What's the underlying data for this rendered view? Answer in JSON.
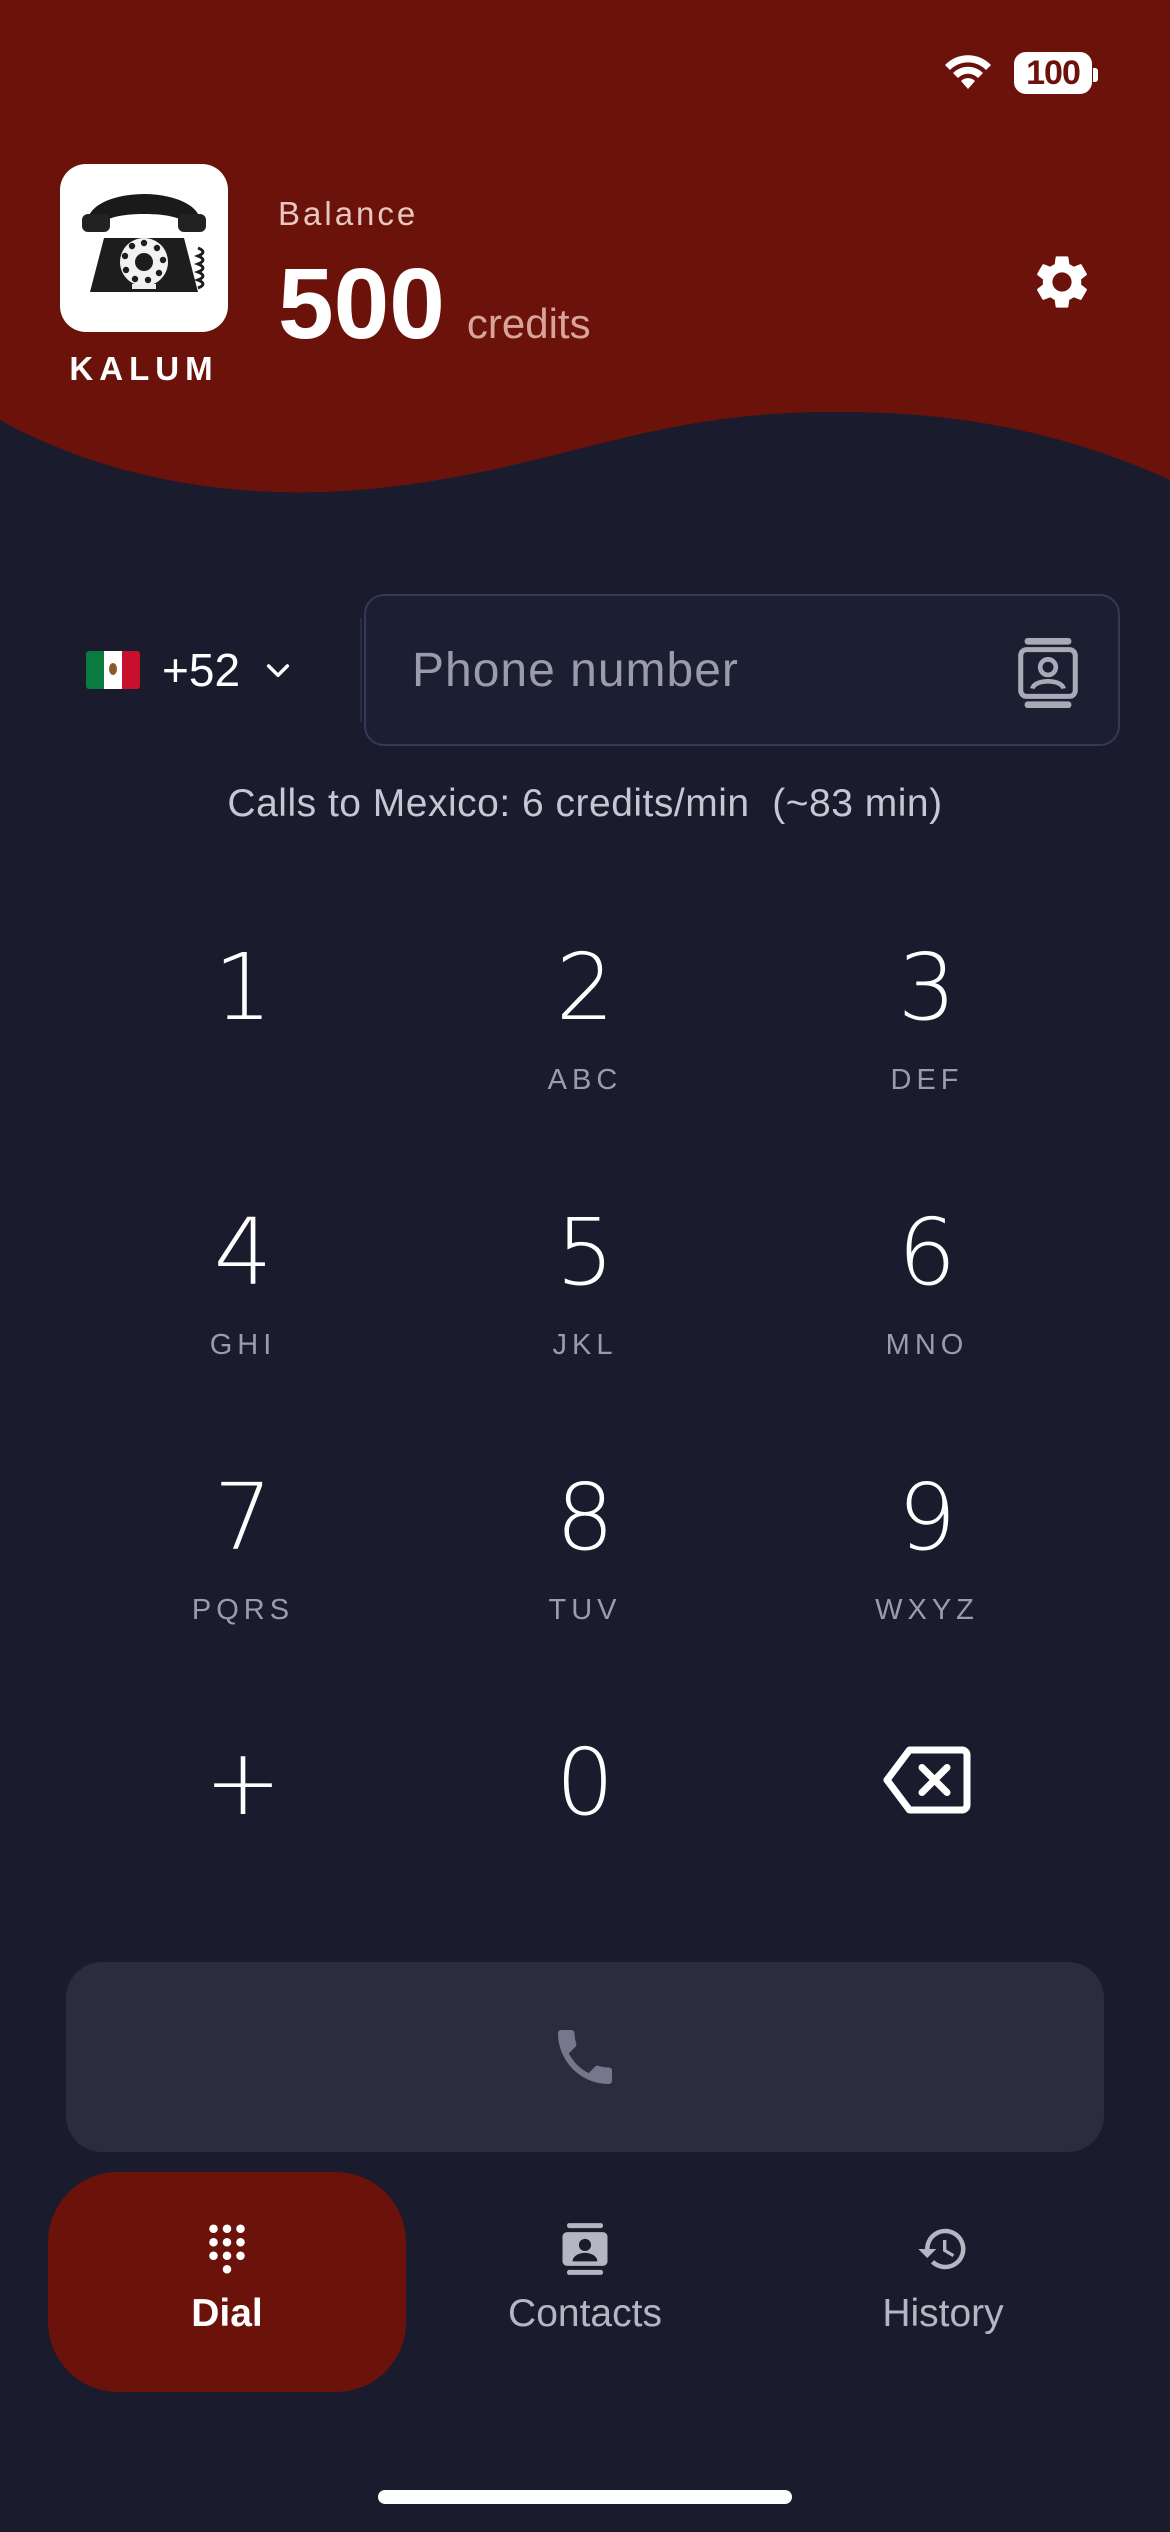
{
  "status_bar": {
    "battery": "100"
  },
  "header": {
    "app_name": "KALUM",
    "balance_label": "Balance",
    "balance_value": "500",
    "balance_unit": "credits"
  },
  "dialer": {
    "country_code": "+52",
    "country_flag": "mexico-flag",
    "phone_placeholder": "Phone number",
    "phone_value": "",
    "rate_text": "Calls to Mexico: 6 credits/min  (~83 min)"
  },
  "keypad": [
    {
      "digit": "1",
      "letters": ""
    },
    {
      "digit": "2",
      "letters": "ABC"
    },
    {
      "digit": "3",
      "letters": "DEF"
    },
    {
      "digit": "4",
      "letters": "GHI"
    },
    {
      "digit": "5",
      "letters": "JKL"
    },
    {
      "digit": "6",
      "letters": "MNO"
    },
    {
      "digit": "7",
      "letters": "PQRS"
    },
    {
      "digit": "8",
      "letters": "TUV"
    },
    {
      "digit": "9",
      "letters": "WXYZ"
    },
    {
      "digit": "+",
      "letters": ""
    },
    {
      "digit": "0",
      "letters": ""
    },
    {
      "digit": "",
      "letters": "",
      "icon": "backspace-icon"
    }
  ],
  "nav": {
    "items": [
      {
        "label": "Dial",
        "icon": "dialpad-icon",
        "active": true
      },
      {
        "label": "Contacts",
        "icon": "contacts-icon",
        "active": false
      },
      {
        "label": "History",
        "icon": "history-icon",
        "active": false
      }
    ]
  },
  "colors": {
    "header_bg": "#6b130b",
    "page_bg": "#1a1b2c",
    "call_button_bg": "#2b2c3e",
    "active_nav_bg": "#6b130b"
  }
}
